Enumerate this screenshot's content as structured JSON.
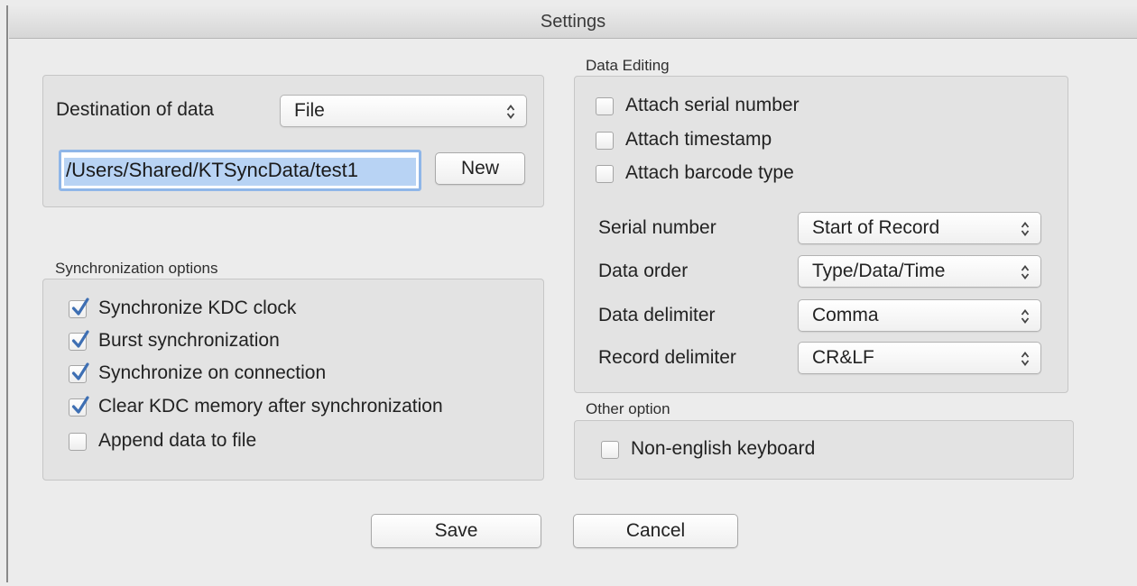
{
  "window": {
    "title": "Settings"
  },
  "destination": {
    "label": "Destination of data",
    "selected": "File",
    "path_value": "/Users/Shared/KTSyncData/test1",
    "new_button": "New"
  },
  "sync": {
    "group_label": "Synchronization options",
    "options": [
      {
        "label": "Synchronize KDC clock",
        "checked": true
      },
      {
        "label": "Burst synchronization",
        "checked": true
      },
      {
        "label": "Synchronize on connection",
        "checked": true
      },
      {
        "label": "Clear KDC memory after synchronization",
        "checked": true
      },
      {
        "label": "Append data to file",
        "checked": false
      }
    ]
  },
  "editing": {
    "group_label": "Data Editing",
    "attach": [
      {
        "label": "Attach serial number",
        "checked": false
      },
      {
        "label": "Attach timestamp",
        "checked": false
      },
      {
        "label": "Attach barcode type",
        "checked": false
      }
    ],
    "fields": [
      {
        "label": "Serial number",
        "value": "Start of Record"
      },
      {
        "label": "Data order",
        "value": "Type/Data/Time"
      },
      {
        "label": "Data delimiter",
        "value": "Comma"
      },
      {
        "label": "Record delimiter",
        "value": "CR&LF"
      }
    ]
  },
  "other": {
    "group_label": "Other option",
    "options": [
      {
        "label": "Non-english keyboard",
        "checked": false
      }
    ]
  },
  "buttons": {
    "save": "Save",
    "cancel": "Cancel"
  },
  "icons": {
    "check": "checkmark-icon",
    "popup": "updown-arrows-icon"
  },
  "colors": {
    "check": "#3e6fb3",
    "selection": "#b8d3f4",
    "focus_ring": "#8fb6e8"
  }
}
